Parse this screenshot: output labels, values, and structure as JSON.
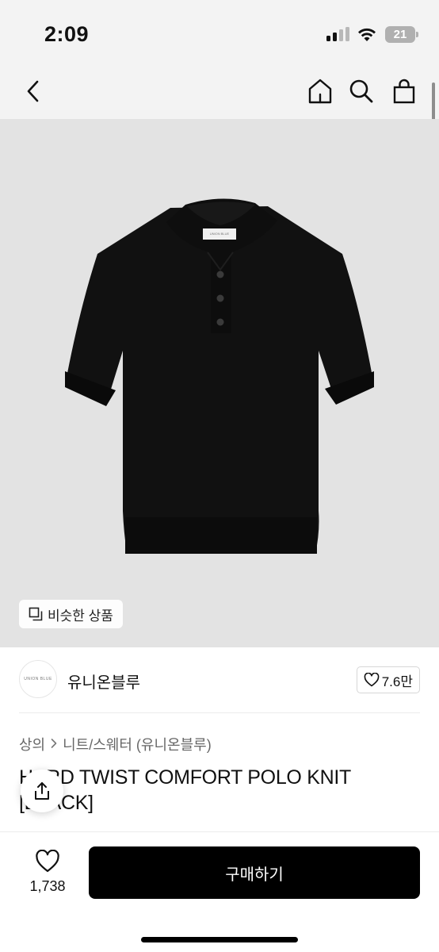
{
  "status_bar": {
    "time": "2:09",
    "battery": "21",
    "icons": [
      "cellular-signal-icon",
      "wifi-icon",
      "battery-icon"
    ]
  },
  "header": {
    "icons": [
      "back-chevron-icon",
      "home-icon",
      "search-icon",
      "shopping-bag-icon"
    ]
  },
  "product_image": {
    "label": "UNION BLUE",
    "similar_label": "비슷한 상품",
    "background_color": "#e3e3e3",
    "product_color": "#111111"
  },
  "shop": {
    "avatar_text": "UNION BLUE",
    "name": "유니온블루",
    "follow_count": "7.6만"
  },
  "breadcrumb": {
    "category": "상의",
    "subcategory": "니트/스웨터 (유니온블루)"
  },
  "product": {
    "title": "HARD TWIST COMFORT POLO KNIT [BLACK]"
  },
  "bottom_bar": {
    "like_count": "1,738",
    "buy_label": "구매하기",
    "accent_color": "#000000"
  }
}
